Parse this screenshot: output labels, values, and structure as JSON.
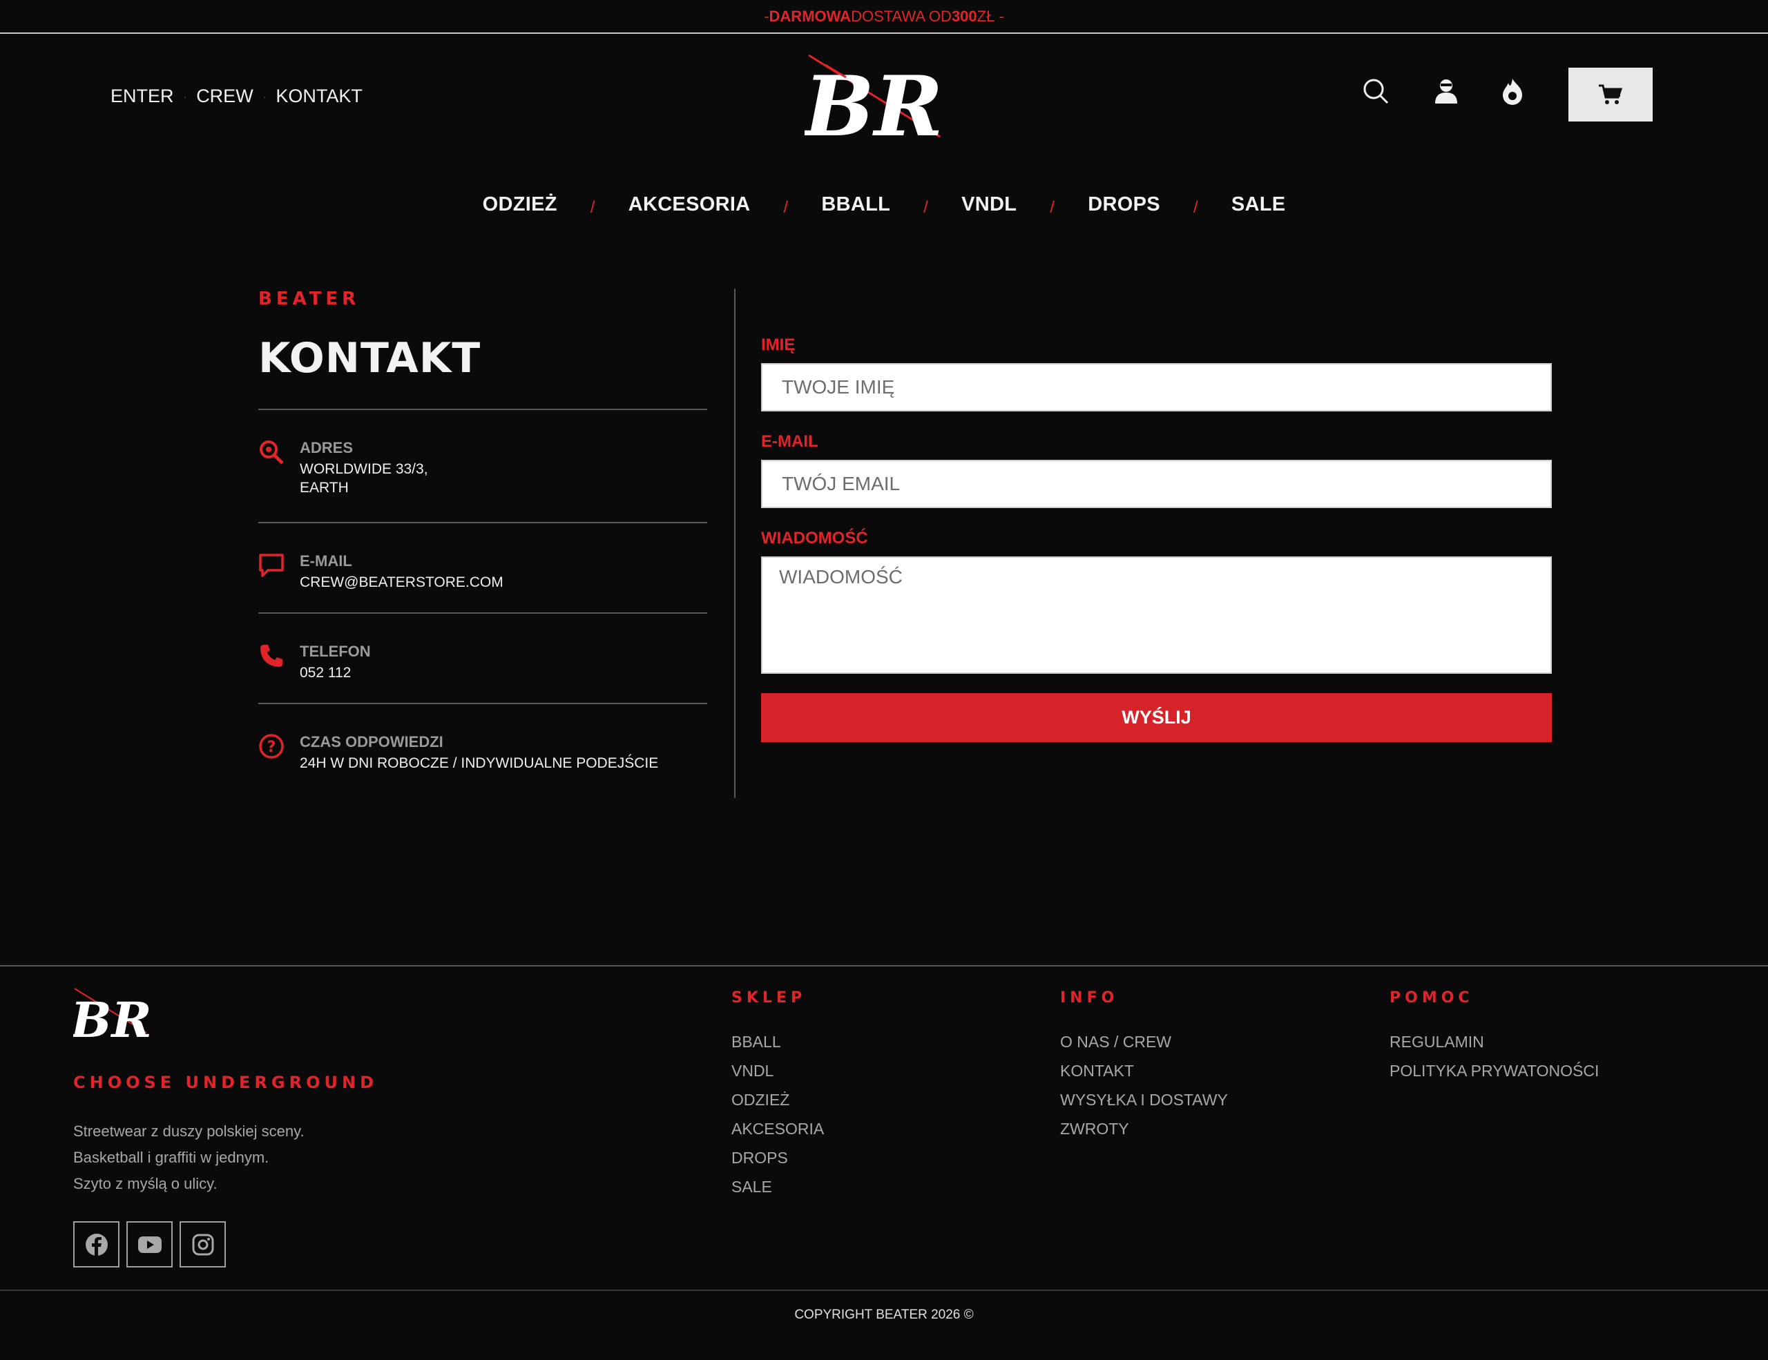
{
  "topbar": {
    "prefix": "- ",
    "bold1": "DARMOWA",
    "mid": " DOSTAWA OD ",
    "bold2": "300",
    "suffix": " ZŁ -"
  },
  "header": {
    "links": [
      "ENTER",
      "CREW",
      "KONTAKT"
    ],
    "logo_text": "BR"
  },
  "nav": [
    "ODZIEŻ",
    "AKCESORIA",
    "BBALL",
    "VNDL",
    "DROPS",
    "SALE"
  ],
  "contact": {
    "brand": "BEATER",
    "title": "KONTAKT",
    "address_label": "ADRES",
    "address_line1": "WORLDWIDE 33/3,",
    "address_line2": "EARTH",
    "email_label": "E-MAIL",
    "email_value": "CREW@BEATERSTORE.COM",
    "phone_label": "TELEFON",
    "phone_value": "052 112",
    "time_label": "CZAS ODPOWIEDZI",
    "time_value": "24H W DNI ROBOCZE / INDYWIDUALNE PODEJŚCIE"
  },
  "form": {
    "name_label": "IMIĘ",
    "name_placeholder": "TWOJE IMIĘ",
    "email_label": "E-MAIL",
    "email_placeholder": "TWÓJ EMAIL",
    "message_label": "WIADOMOŚĆ",
    "message_placeholder": "WIADOMOŚĆ",
    "submit": "WYŚLIJ"
  },
  "footer": {
    "tagline": "CHOOSE UNDERGROUND",
    "desc1": "Streetwear z duszy polskiej sceny.",
    "desc2": "Basketball i graffiti w jednym.",
    "desc3": "Szyto z myślą o ulicy.",
    "shop_title": "SKLEP",
    "shop": [
      "BBALL",
      "VNDL",
      "ODZIEŻ",
      "AKCESORIA",
      "DROPS",
      "SALE"
    ],
    "info_title": "INFO",
    "info": [
      "O NAS / CREW",
      "KONTAKT",
      "WYSYŁKA I DOSTAWY",
      "ZWROTY"
    ],
    "help_title": "POMOC",
    "help": [
      "REGULAMIN",
      "POLITYKA PRYWATONOŚCI"
    ],
    "copyright": "COPYRIGHT BEATER 2026  ©"
  },
  "colors": {
    "accent": "#e0242a",
    "background": "#0a0a0a"
  },
  "icons": [
    "search-icon",
    "user-icon",
    "flame-icon",
    "cart-icon",
    "location-search-icon",
    "chat-icon",
    "phone-icon",
    "question-icon",
    "facebook-icon",
    "youtube-icon",
    "instagram-icon"
  ]
}
